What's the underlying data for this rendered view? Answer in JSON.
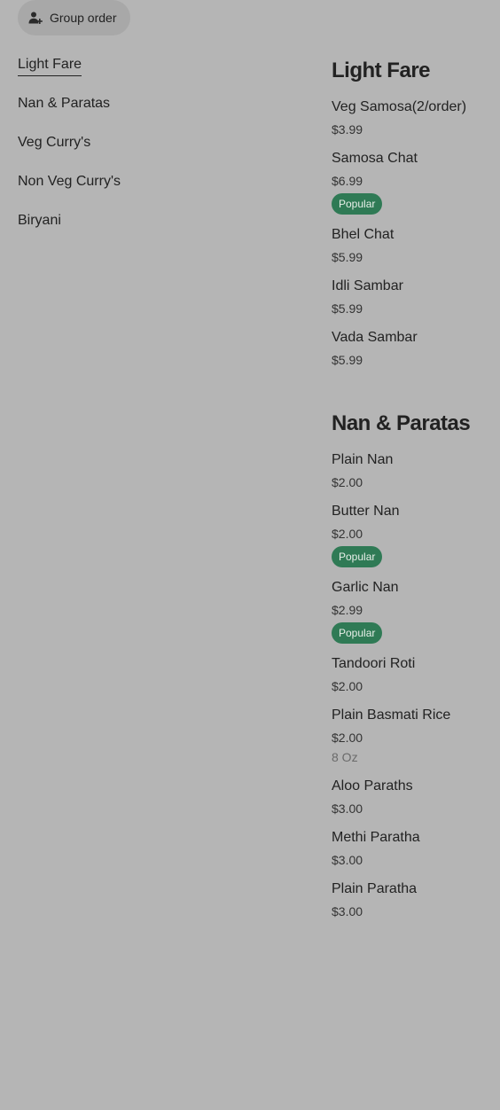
{
  "group_order": {
    "label": "Group order",
    "icon": "add-person-icon"
  },
  "nav": {
    "items": [
      {
        "label": "Light Fare",
        "active": true
      },
      {
        "label": "Nan & Paratas",
        "active": false
      },
      {
        "label": "Veg Curry's",
        "active": false
      },
      {
        "label": "Non Veg Curry's",
        "active": false
      },
      {
        "label": "Biryani",
        "active": false
      }
    ]
  },
  "badge_color": "#2f7a55",
  "sections": [
    {
      "title": "Light Fare",
      "items": [
        {
          "name": "Veg Samosa(2/order)",
          "price": "$3.99"
        },
        {
          "name": "Samosa Chat",
          "price": "$6.99",
          "badge": "Popular"
        },
        {
          "name": "Bhel Chat",
          "price": "$5.99"
        },
        {
          "name": "Idli Sambar",
          "price": "$5.99"
        },
        {
          "name": "Vada Sambar",
          "price": "$5.99"
        }
      ]
    },
    {
      "title": "Nan & Paratas",
      "items": [
        {
          "name": "Plain Nan",
          "price": "$2.00"
        },
        {
          "name": "Butter Nan",
          "price": "$2.00",
          "badge": "Popular"
        },
        {
          "name": "Garlic Nan",
          "price": "$2.99",
          "badge": "Popular"
        },
        {
          "name": "Tandoori Roti",
          "price": "$2.00"
        },
        {
          "name": "Plain Basmati Rice",
          "price": "$2.00",
          "note": "8 Oz"
        },
        {
          "name": "Aloo Paraths",
          "price": "$3.00"
        },
        {
          "name": "Methi Paratha",
          "price": "$3.00"
        },
        {
          "name": "Plain Paratha",
          "price": "$3.00"
        }
      ]
    }
  ]
}
